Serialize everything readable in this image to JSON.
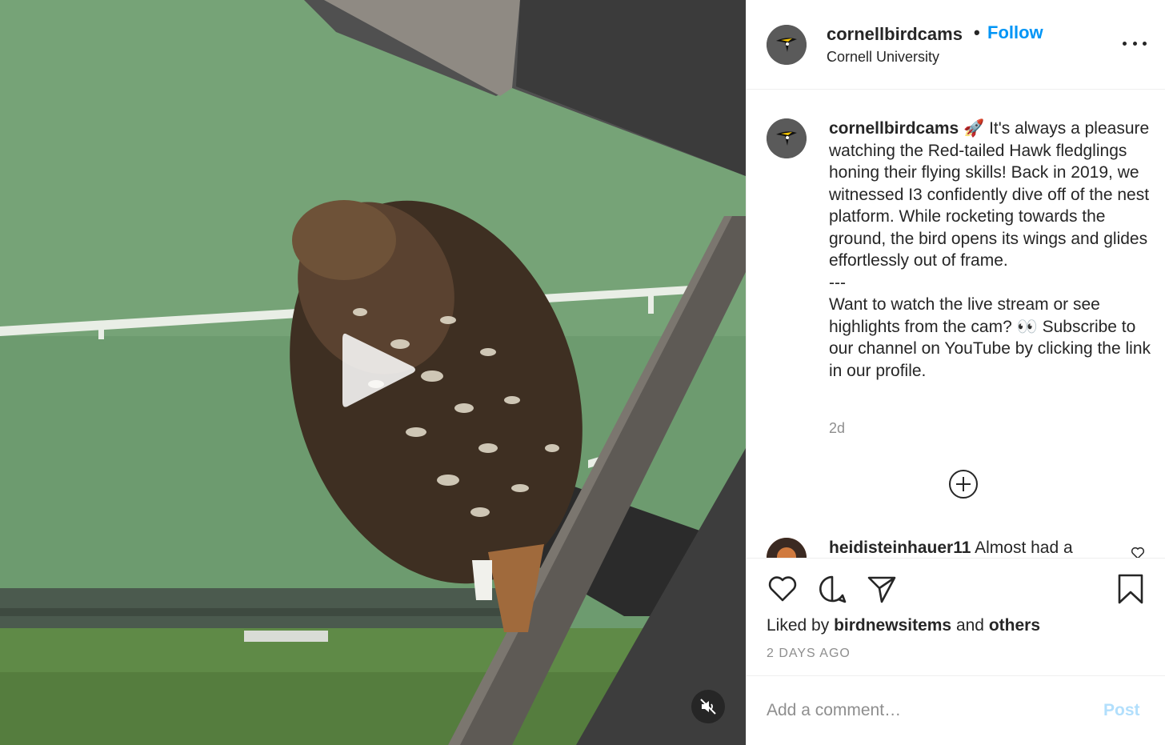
{
  "post": {
    "username": "cornellbirdcams",
    "separator": "•",
    "follow_label": "Follow",
    "location": "Cornell University",
    "caption": {
      "emoji": "🚀",
      "paragraph1": "It's always a pleasure watching the Red-tailed Hawk fledglings honing their flying skills! Back in 2019, we witnessed I3 confidently dive off of the nest platform. While rocketing towards the ground, the bird opens its wings and glides effortlessly out of frame.",
      "divider": "---",
      "paragraph2": "Want to watch the live stream or see highlights from the cam? 👀 Subscribe to our channel on YouTube by clicking the link in our profile."
    },
    "age": "2d",
    "comments": [
      {
        "username": "heidisteinhauer11",
        "text": "Almost had a"
      }
    ],
    "liked_by": {
      "prefix": "Liked by",
      "user": "birdnewsitems",
      "conjunction": "and",
      "others": "others"
    },
    "timestamp": "2 DAYS AGO",
    "add_comment_placeholder": "Add a comment…",
    "post_label": "Post"
  },
  "icons": {
    "video": [
      "play-icon",
      "muted-speaker-icon"
    ],
    "actions": [
      "heart-icon",
      "comment-bubble-icon",
      "share-paper-plane-icon",
      "bookmark-icon"
    ],
    "more": "more-options-icon",
    "load_more": "plus-circle-icon"
  },
  "colors": {
    "link_blue": "#0095f6",
    "post_disabled": "#b2dffc",
    "secondary_text": "#8e8e8e"
  }
}
